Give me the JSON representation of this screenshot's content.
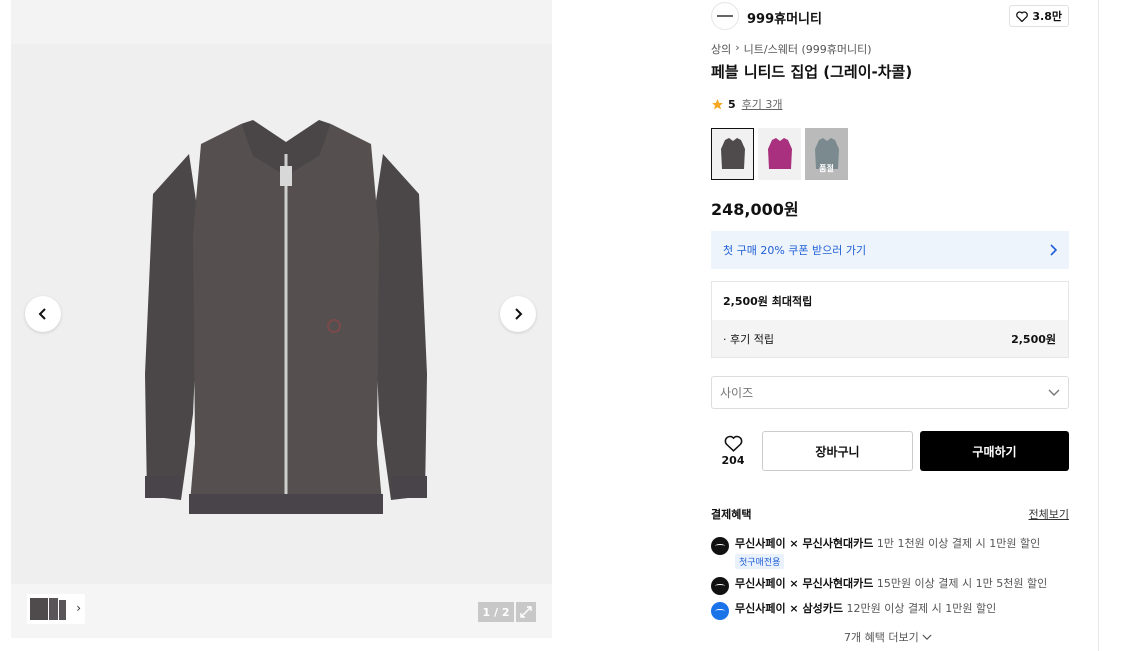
{
  "brand": {
    "name": "999휴머니티",
    "likes": "3.8만"
  },
  "breadcrumb": {
    "category": "상의",
    "separator": "›",
    "sub": "니트/스웨터 (999휴머니티)"
  },
  "product": {
    "title": "페블 니티드 집업 (그레이-차콜)",
    "rating": "5",
    "reviews": "후기 3개",
    "price": "248,000원"
  },
  "swatches": [
    {
      "color": "gray-charcoal",
      "hex": "#4f4a4c",
      "selected": true
    },
    {
      "color": "magenta",
      "hex": "#a8307f",
      "selected": false
    },
    {
      "color": "blue-gray",
      "hex": "#7d9aa0",
      "selected": false,
      "label": "품절"
    }
  ],
  "coupon": {
    "text": "첫 구매 20% 쿠폰 받으러 가기"
  },
  "points": {
    "title": "2,500원 최대적립",
    "rows": [
      {
        "label": "· 후기 적립",
        "amount": "2,500원"
      }
    ]
  },
  "size": {
    "placeholder": "사이즈"
  },
  "actions": {
    "wish_count": "204",
    "cart": "장바구니",
    "buy": "구매하기"
  },
  "benefits": {
    "title": "결제혜택",
    "see_all": "전체보기",
    "items": [
      {
        "title": "무신사페이 × 무신사현대카드",
        "desc": "1만 1천원 이상 결제 시 1만원 할인",
        "tag": "첫구매전용",
        "icon": "black"
      },
      {
        "title": "무신사페이 × 무신사현대카드",
        "desc": "15만원 이상 결제 시 1만 5천원 할인",
        "icon": "black"
      },
      {
        "title": "무신사페이 × 삼성카드",
        "desc": "12만원 이상 결제 시 1만원 할인",
        "icon": "blue"
      }
    ],
    "more": "7개 혜택 더보기"
  },
  "gallery": {
    "counter": "1 / 2",
    "icons": [
      "chevron-left-icon",
      "chevron-right-icon",
      "expand-icon"
    ]
  },
  "colors": {
    "accent": "#1f5fd6",
    "buy_bg": "#000000",
    "coupon_bg": "#eef4fc",
    "star": "#f5a623"
  }
}
